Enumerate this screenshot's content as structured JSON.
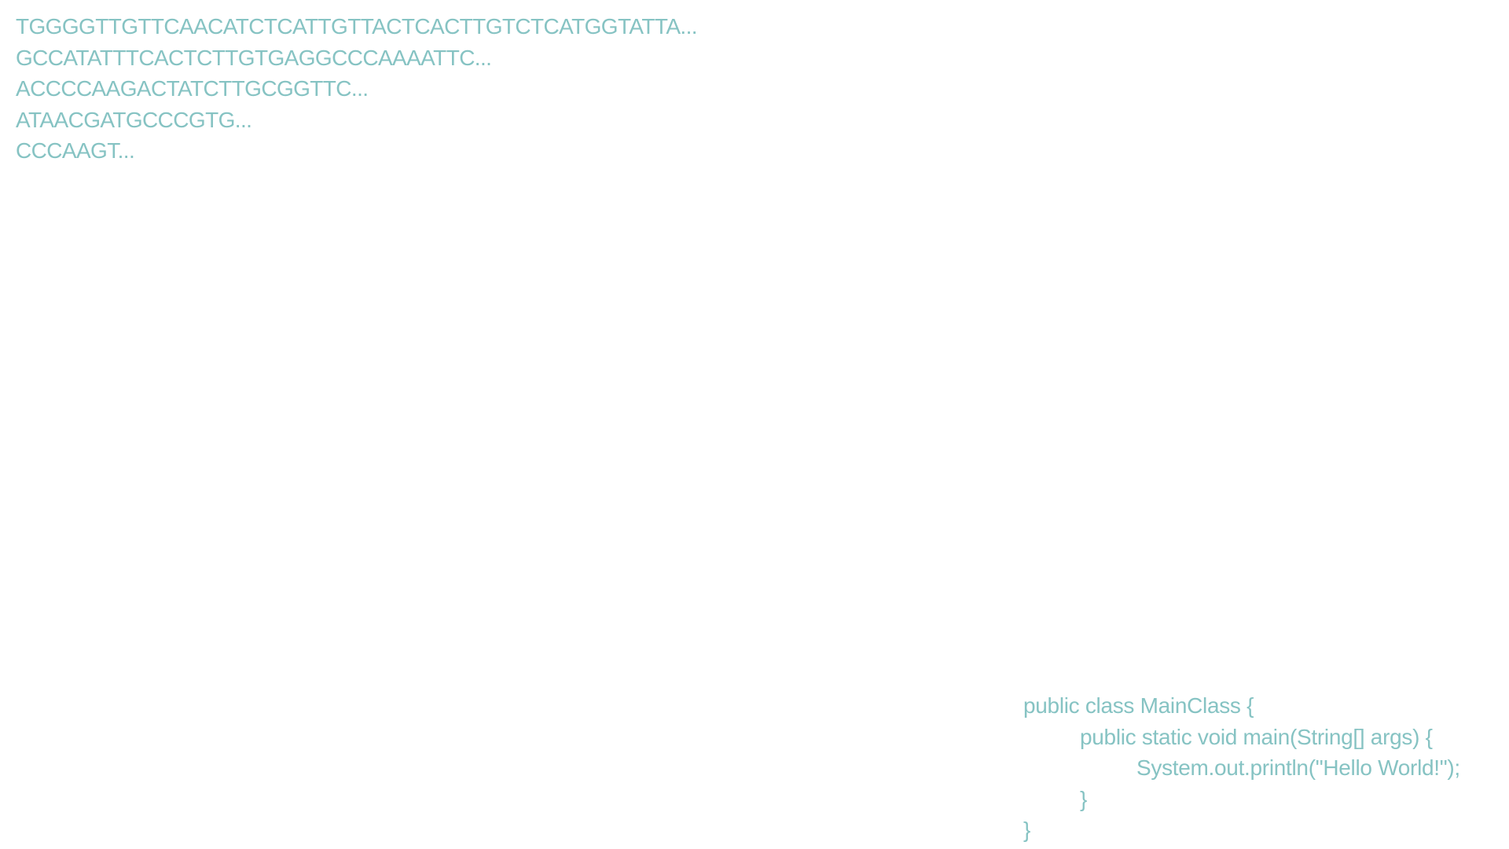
{
  "dna_sequences": [
    "TGGGGTTGTTCAACATCTCATTGTTACTCACTTGTCTCATGGTATTA...",
    "GCCATATTTCACTCTTGTGAGGCCCAAAATTC...",
    "ACCCCAAGACTATCTTGCGGTTC...",
    "ATAACGATGCCCGTG...",
    "CCCAAGT..."
  ],
  "code_lines": [
    "public class MainClass {",
    "public static void main(String[] args) {",
    "System.out.println(\"Hello World!\");",
    "}",
    "}"
  ],
  "colors": {
    "text": "#86c3c3",
    "background": "#ffffff"
  }
}
